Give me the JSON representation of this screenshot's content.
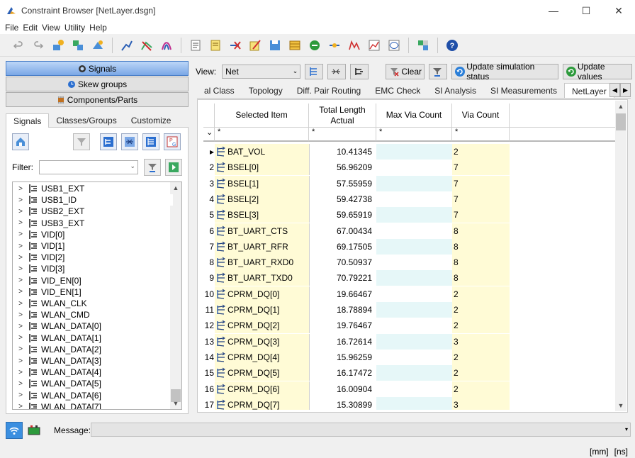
{
  "window": {
    "title": "Constraint Browser [NetLayer.dsgn]",
    "minimize": "—",
    "maximize": "☐",
    "close": "✕"
  },
  "menu": [
    "File",
    "Edit",
    "View",
    "Utility",
    "Help"
  ],
  "left": {
    "nav": [
      {
        "label": "Signals",
        "icon": "globe-icon",
        "active": true
      },
      {
        "label": "Skew groups",
        "icon": "clock-icon",
        "active": false
      },
      {
        "label": "Components/Parts",
        "icon": "component-icon",
        "active": false
      }
    ],
    "subtabs": [
      "Signals",
      "Classes/Groups",
      "Customize"
    ],
    "filter_label": "Filter:",
    "filter_value": "",
    "tree": [
      "USB1_EXT",
      "USB1_ID",
      "USB2_EXT",
      "USB3_EXT",
      "VID[0]",
      "VID[1]",
      "VID[2]",
      "VID[3]",
      "VID_EN[0]",
      "VID_EN[1]",
      "WLAN_CLK",
      "WLAN_CMD",
      "WLAN_DATA[0]",
      "WLAN_DATA[1]",
      "WLAN_DATA[2]",
      "WLAN_DATA[3]",
      "WLAN_DATA[4]",
      "WLAN_DATA[5]",
      "WLAN_DATA[6]",
      "WLAN_DATA[7]"
    ],
    "tree_selected": "USB1_ID"
  },
  "right": {
    "view_label": "View:",
    "view_value": "Net",
    "clear_label": "Clear",
    "update_sim_label": "Update simulation status",
    "update_values_label": "Update values",
    "tabs": [
      "al Class",
      "Topology",
      "Diff. Pair Routing",
      "EMC Check",
      "SI Analysis",
      "SI Measurements",
      "NetLayer"
    ],
    "active_tab": "NetLayer",
    "columns": [
      "Selected Item",
      "Total Length Actual",
      "Max Via Count",
      "Via Count"
    ],
    "filter_symbol": "*",
    "rows": [
      {
        "idx": "",
        "name": "BAT_VOL",
        "len": "10.41345",
        "max": "",
        "via": "2"
      },
      {
        "idx": "2",
        "name": "BSEL[0]",
        "len": "56.96209",
        "max": "",
        "via": "7"
      },
      {
        "idx": "3",
        "name": "BSEL[1]",
        "len": "57.55959",
        "max": "",
        "via": "7"
      },
      {
        "idx": "4",
        "name": "BSEL[2]",
        "len": "59.42738",
        "max": "",
        "via": "7"
      },
      {
        "idx": "5",
        "name": "BSEL[3]",
        "len": "59.65919",
        "max": "",
        "via": "7"
      },
      {
        "idx": "6",
        "name": "BT_UART_CTS",
        "len": "67.00434",
        "max": "",
        "via": "8"
      },
      {
        "idx": "7",
        "name": "BT_UART_RFR",
        "len": "69.17505",
        "max": "",
        "via": "8"
      },
      {
        "idx": "8",
        "name": "BT_UART_RXD0",
        "len": "70.50937",
        "max": "",
        "via": "8"
      },
      {
        "idx": "9",
        "name": "BT_UART_TXD0",
        "len": "70.79221",
        "max": "",
        "via": "8"
      },
      {
        "idx": "10",
        "name": "CPRM_DQ[0]",
        "len": "19.66467",
        "max": "",
        "via": "2"
      },
      {
        "idx": "11",
        "name": "CPRM_DQ[1]",
        "len": "18.78894",
        "max": "",
        "via": "2"
      },
      {
        "idx": "12",
        "name": "CPRM_DQ[2]",
        "len": "19.76467",
        "max": "",
        "via": "2"
      },
      {
        "idx": "13",
        "name": "CPRM_DQ[3]",
        "len": "16.72614",
        "max": "",
        "via": "3"
      },
      {
        "idx": "14",
        "name": "CPRM_DQ[4]",
        "len": "15.96259",
        "max": "",
        "via": "2"
      },
      {
        "idx": "15",
        "name": "CPRM_DQ[5]",
        "len": "16.17472",
        "max": "",
        "via": "2"
      },
      {
        "idx": "16",
        "name": "CPRM_DQ[6]",
        "len": "16.00904",
        "max": "",
        "via": "2"
      },
      {
        "idx": "17",
        "name": "CPRM_DQ[7]",
        "len": "15.30899",
        "max": "",
        "via": "3"
      }
    ]
  },
  "bottom": {
    "message_label": "Message:",
    "message_value": "",
    "units": [
      "[mm]",
      "[ns]"
    ]
  },
  "colors": {
    "name_cell": "#fffbd6",
    "max_cell": "#e6f7f8",
    "accent": "#3b8fe0"
  }
}
